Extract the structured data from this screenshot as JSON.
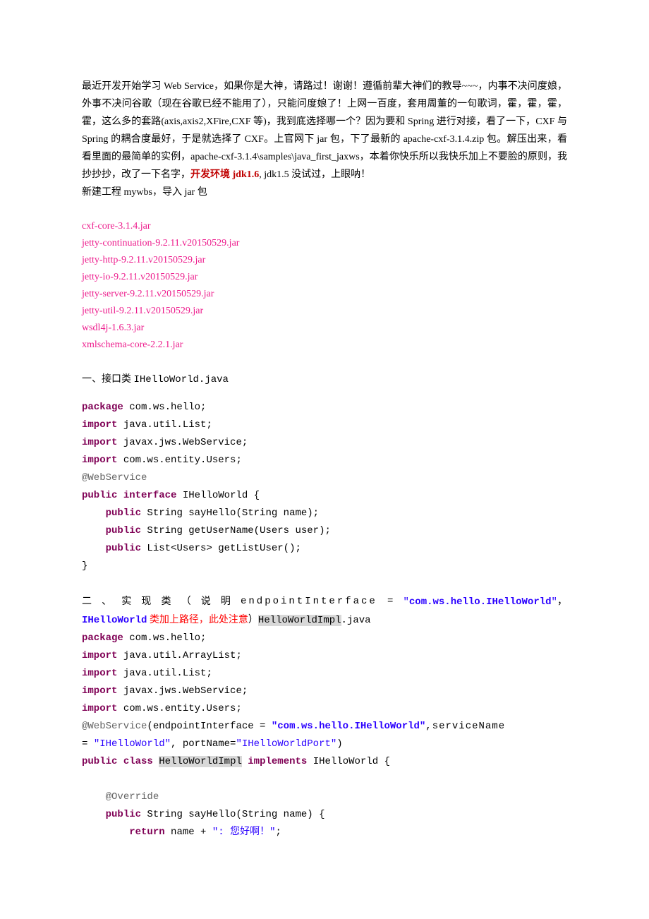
{
  "intro": {
    "p1_a": "最近开发开始学习 Web Service，如果你是大神，请路过！谢谢！遵循前辈大神们的教导~~~，内事不决问度娘，外事不决问谷歌（现在谷歌已经不能用了），只能问度娘了！上网一百度，套用周董的一句歌词，霍，霍，霍，霍，这么多的套路(axis,axis2,XFire,CXF 等)，我到底选择哪一个？因为要和 Spring 进行对接，看了一下，CXF 与 Spring 的耦合度最好，于是就选择了 CXF。上官网下 jar 包，下了最新的 apache-cxf-3.1.4.zip 包。解压出来，看看里面的最简单的实例，apache-cxf-3.1.4\\samples\\java_first_jaxws，本着你快乐所以我快乐加上不要脸的原则，我抄抄抄，改了一下名字，",
    "p1_env": "开发环境 jdk1.6",
    "p1_b": ", jdk1.5 没试过，上眼呐！",
    "p2": "新建工程 mywbs，导入 jar 包"
  },
  "jars": [
    "cxf-core-3.1.4.jar",
    "jetty-continuation-9.2.11.v20150529.jar",
    "jetty-http-9.2.11.v20150529.jar",
    "jetty-io-9.2.11.v20150529.jar",
    "jetty-server-9.2.11.v20150529.jar",
    "jetty-util-9.2.11.v20150529.jar",
    "wsdl4j-1.6.3.jar",
    "xmlschema-core-2.2.1.jar"
  ],
  "section1": {
    "title_a": "一、接口类 ",
    "title_b": "IHelloWorld.java",
    "code": {
      "l1_kw": "package",
      "l1_rest": " com.ws.hello;",
      "l2_kw": "import",
      "l2_rest": " java.util.List;",
      "l3_kw": "import",
      "l3_rest": " javax.jws.WebService;",
      "l4_kw": "import",
      "l4_rest": " com.ws.entity.Users;",
      "l5_ann": "@WebService",
      "l6_kw1": "public",
      "l6_kw2": "interface",
      "l6_rest": " IHelloWorld {",
      "l7_kw": "public",
      "l7_rest": " String sayHello(String name);",
      "l8_kw": "public",
      "l8_rest": " String getUserName(Users user);",
      "l9_kw": "public",
      "l9_rest": " List<Users> getListUser();",
      "l10": "}"
    }
  },
  "section2": {
    "title_parts": {
      "a1": "二",
      "a2": "、",
      "a3": "实",
      "a4": "现",
      "a5": "类",
      "a6": "（",
      "a7": "说",
      "a8": "明",
      "b": "endpointInterface",
      "eq": "=",
      "q1": "\"",
      "str1": "com.ws.hello.IHelloWorld",
      "q2": "\"",
      "comma": "，",
      "cls": "IHelloWorld",
      "note": " 类加上路径，此处注意",
      "paren": "）",
      "file": "HelloWorldImpl",
      "ext": ".java"
    },
    "code": {
      "l1_kw": "package",
      "l1_rest": " com.ws.hello;",
      "l2_kw": "import",
      "l2_rest": " java.util.ArrayList;",
      "l3_kw": "import",
      "l3_rest": " java.util.List;",
      "l4_kw": "import",
      "l4_rest": " javax.jws.WebService;",
      "l5_kw": "import",
      "l5_rest": " com.ws.entity.Users;",
      "l6_ann1": "@WebService",
      "l6_rest1": "(endpointInterface = ",
      "l6_str1": "\"com.ws.hello.IHelloWorld\"",
      "l6_rest2": ",serviceName",
      "l7_rest1": "= ",
      "l7_str1": "\"IHelloWorld\"",
      "l7_rest2": ", portName=",
      "l7_str2": "\"IHelloWorldPort\"",
      "l7_rest3": ")",
      "l8_kw1": "public",
      "l8_kw2": "class",
      "l8_hl": "HelloWorldImpl",
      "l8_kw3": "implements",
      "l8_rest": " IHelloWorld {",
      "l10_ann": "@Override",
      "l11_kw": "public",
      "l11_rest": " String sayHello(String name) {",
      "l12_kw": "return",
      "l12_rest1": " name + ",
      "l12_str": "\": 您好啊！\"",
      "l12_rest2": ";"
    }
  }
}
